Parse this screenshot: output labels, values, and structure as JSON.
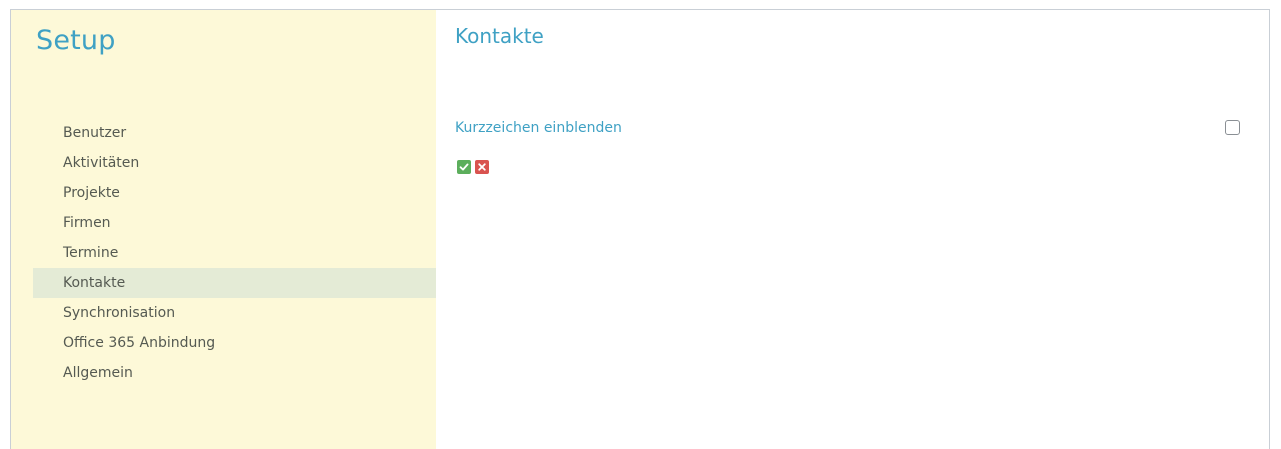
{
  "sidebar": {
    "title": "Setup",
    "items": [
      {
        "label": "Benutzer"
      },
      {
        "label": "Aktivitäten"
      },
      {
        "label": "Projekte"
      },
      {
        "label": "Firmen"
      },
      {
        "label": "Termine"
      },
      {
        "label": "Kontakte",
        "active": true
      },
      {
        "label": "Synchronisation"
      },
      {
        "label": "Office 365 Anbindung"
      },
      {
        "label": "Allgemein"
      }
    ]
  },
  "main": {
    "title": "Kontakte",
    "setting": {
      "label": "Kurzzeichen einblenden",
      "checked": false
    },
    "actions": {
      "confirm_icon": "check-icon",
      "cancel_icon": "close-icon"
    }
  },
  "colors": {
    "accent": "#3fa1c4",
    "sidebar_bg": "#fdf9d8",
    "active_bg": "#e4ebd6",
    "confirm": "#5cae5c",
    "cancel": "#d9534f"
  }
}
